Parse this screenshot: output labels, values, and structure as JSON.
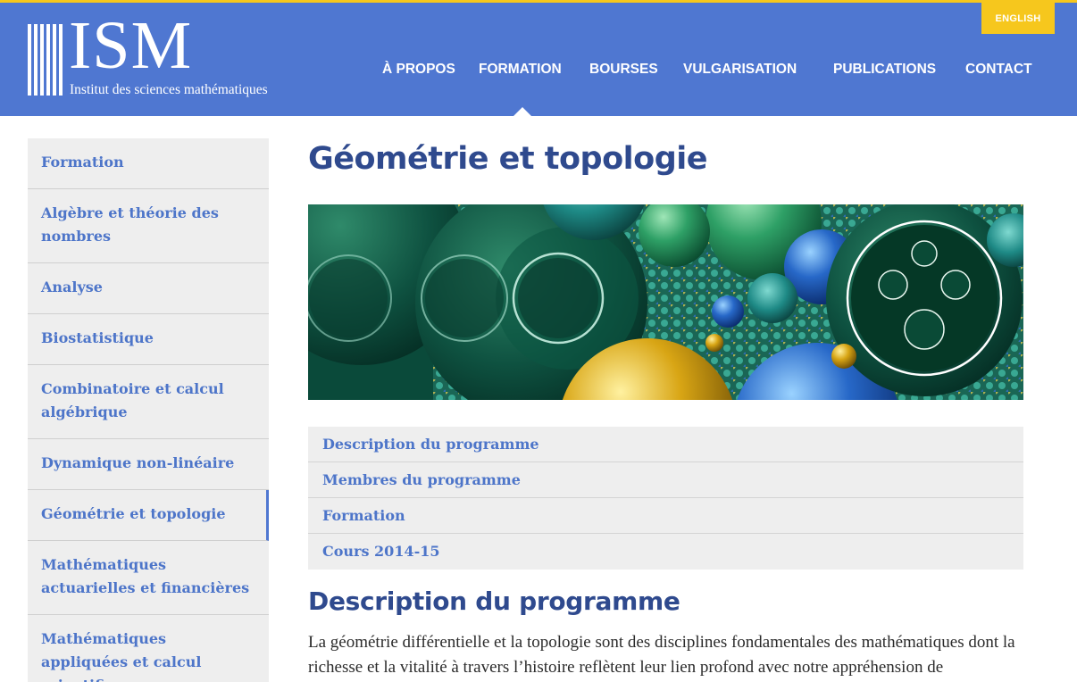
{
  "header": {
    "logo_text": "ISM",
    "logo_subtitle": "Institut des sciences mathématiques",
    "language_button": "ENGLISH",
    "nav": [
      {
        "label": "À PROPOS"
      },
      {
        "label": "FORMATION"
      },
      {
        "label": "BOURSES"
      },
      {
        "label": "VULGARISATION"
      },
      {
        "label": "PUBLICATIONS"
      },
      {
        "label": "CONTACT"
      }
    ],
    "active_nav": "FORMATION"
  },
  "sidebar": {
    "items": [
      {
        "label": "Formation"
      },
      {
        "label": "Algèbre et théorie des nombres"
      },
      {
        "label": "Analyse"
      },
      {
        "label": "Biostatistique"
      },
      {
        "label": "Combinatoire et calcul algébrique"
      },
      {
        "label": "Dynamique non-linéaire"
      },
      {
        "label": "Géométrie et topologie"
      },
      {
        "label": "Mathématiques actuarielles et financières"
      },
      {
        "label": "Mathématiques appliquées et calcul scientifique"
      }
    ],
    "active_item": "Géométrie et topologie"
  },
  "main": {
    "title": "Géométrie et topologie",
    "tabs": [
      {
        "label": "Description du programme"
      },
      {
        "label": "Membres du programme"
      },
      {
        "label": "Formation"
      },
      {
        "label": "Cours 2014-15"
      }
    ],
    "section_title": "Description du programme",
    "body_text": "La géométrie différentielle et la topologie sont des disciplines fondamentales des mathématiques dont la richesse et la vitalité à travers l’histoire reflètent leur lien profond avec notre appréhension de"
  },
  "colors": {
    "header_blue": "#4f77d1",
    "accent_yellow": "#f6c71d",
    "title_navy": "#2f4a8e",
    "link_blue": "#4d75c9",
    "panel_gray": "#eeeeee"
  }
}
